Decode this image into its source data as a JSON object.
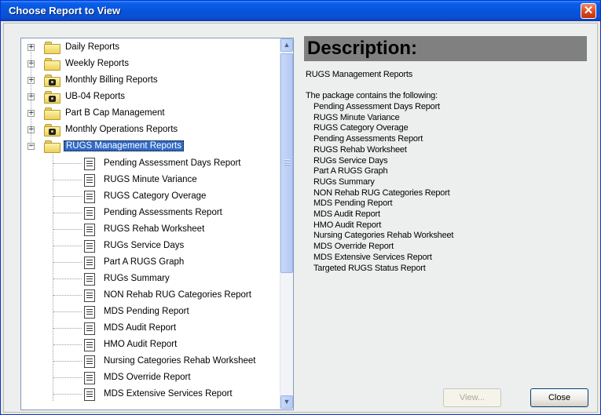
{
  "window": {
    "title": "Choose Report to View",
    "close_glyph": "✕"
  },
  "tree": {
    "folders": [
      {
        "label": "Daily Reports",
        "expander": "+",
        "icon": "folder-icon",
        "locked": false
      },
      {
        "label": "Weekly Reports",
        "expander": "+",
        "icon": "folder-icon",
        "locked": false
      },
      {
        "label": "Monthly Billing Reports",
        "expander": "+",
        "icon": "locked-folder-icon",
        "locked": true
      },
      {
        "label": "UB-04 Reports",
        "expander": "+",
        "icon": "locked-folder-icon",
        "locked": true
      },
      {
        "label": "Part B Cap Management",
        "expander": "+",
        "icon": "folder-icon",
        "locked": false
      },
      {
        "label": "Monthly Operations Reports",
        "expander": "+",
        "icon": "locked-folder-icon",
        "locked": true
      },
      {
        "label": "RUGS Management Reports",
        "expander": "−",
        "icon": "open-folder-icon",
        "locked": false,
        "selected": true
      }
    ],
    "reports": [
      "Pending Assessment Days Report",
      "RUGS Minute Variance",
      "RUGS Category Overage",
      "Pending Assessments Report",
      "RUGS Rehab Worksheet",
      "RUGs Service Days",
      "Part A RUGS Graph",
      "RUGs Summary",
      "NON Rehab RUG Categories Report",
      "MDS Pending Report",
      "MDS Audit Report",
      "HMO Audit Report",
      "Nursing Categories Rehab Worksheet",
      "MDS Override Report",
      "MDS Extensive Services Report"
    ],
    "scroll_up": "▲",
    "scroll_down": "▼"
  },
  "description": {
    "title": "Description:",
    "name": "RUGS Management Reports",
    "intro": "The package contains the following:",
    "items": [
      "Pending Assessment Days Report",
      "RUGS Minute Variance",
      "RUGS Category Overage",
      "Pending Assessments Report",
      "RUGS Rehab Worksheet",
      "RUGs Service Days",
      "Part A RUGS Graph",
      "RUGs Summary",
      "NON Rehab RUG Categories Report",
      "MDS Pending Report",
      "MDS Audit Report",
      "HMO Audit Report",
      "Nursing Categories Rehab Worksheet",
      "MDS Override Report",
      "MDS Extensive Services Report",
      "Targeted RUGS Status Report"
    ]
  },
  "buttons": {
    "view_label": "View...",
    "close_label": "Close"
  },
  "colors": {
    "title_bar": "#0a5fe8",
    "selection": "#316ac5",
    "description_header": "#808080"
  }
}
